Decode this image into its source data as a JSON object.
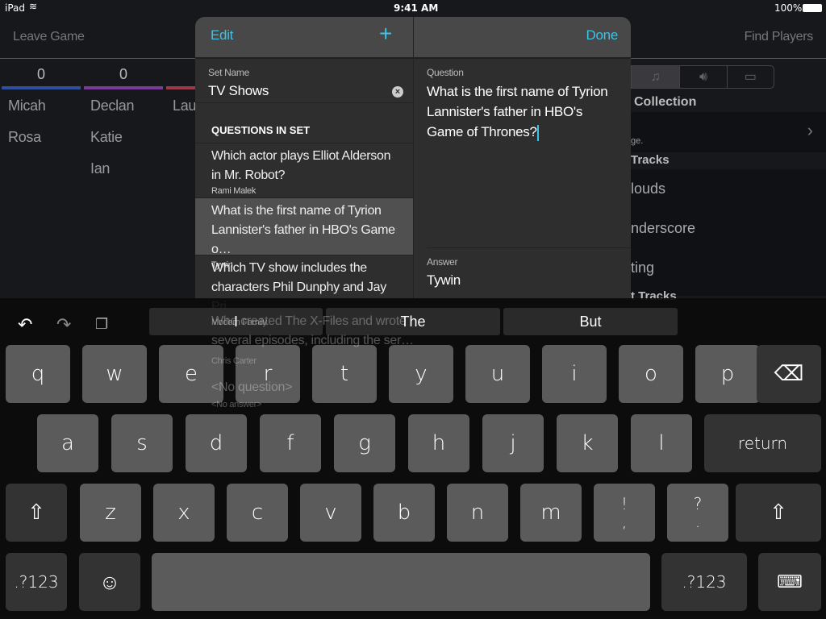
{
  "status": {
    "device": "iPad",
    "time": "9:41 AM",
    "battery": "100%"
  },
  "nav": {
    "leave": "Leave Game",
    "find": "Find Players"
  },
  "teams": [
    {
      "score": "0",
      "color": "#2e4ea0",
      "players": [
        "Micah",
        "Rosa"
      ]
    },
    {
      "score": "0",
      "color": "#7a3a9a",
      "players": [
        "Declan",
        "Katie",
        "Ian"
      ]
    },
    {
      "score": "",
      "color": "#9a3a4a",
      "players": [
        "Laur"
      ]
    }
  ],
  "right_panel": {
    "section1": "Collection",
    "row1_sub": "ge.",
    "section2": "Tracks",
    "items": [
      "louds",
      "nderscore",
      "ting"
    ],
    "section3": "t Tracks"
  },
  "popover": {
    "edit": "Edit",
    "done": "Done",
    "set_name_label": "Set Name",
    "set_name": "TV Shows",
    "questions_header": "QUESTIONS IN SET",
    "questions": [
      {
        "q": "Which actor plays Elliot Alderson in Mr. Robot?",
        "a": "Rami Malek"
      },
      {
        "q": "What is the first name of Tyrion Lannister's father in HBO's Game o…",
        "a": "Tywin"
      },
      {
        "q": "Which TV show includes the characters Phil Dunphy and Jay Pri…",
        "a": "Modern Family"
      }
    ],
    "behind": [
      "Who created The X-Files and wrote",
      "several episodes, including the ser…",
      "Chris Carter",
      "<No question>",
      "<No answer>"
    ],
    "question_label": "Question",
    "question": "What is the first name of Tyrion Lannister's father in HBO's Game of Thrones?",
    "answer_label": "Answer",
    "answer": "Tywin"
  },
  "keyboard": {
    "suggestions": [
      "I",
      "The",
      "But"
    ],
    "row1": [
      "q",
      "w",
      "e",
      "r",
      "t",
      "y",
      "u",
      "i",
      "o",
      "p"
    ],
    "row2": [
      "a",
      "s",
      "d",
      "f",
      "g",
      "h",
      "j",
      "k",
      "l"
    ],
    "return": "return",
    "row3": [
      "z",
      "x",
      "c",
      "v",
      "b",
      "n",
      "m",
      "!\n,",
      "?\n."
    ],
    "numbers": ".?123"
  }
}
